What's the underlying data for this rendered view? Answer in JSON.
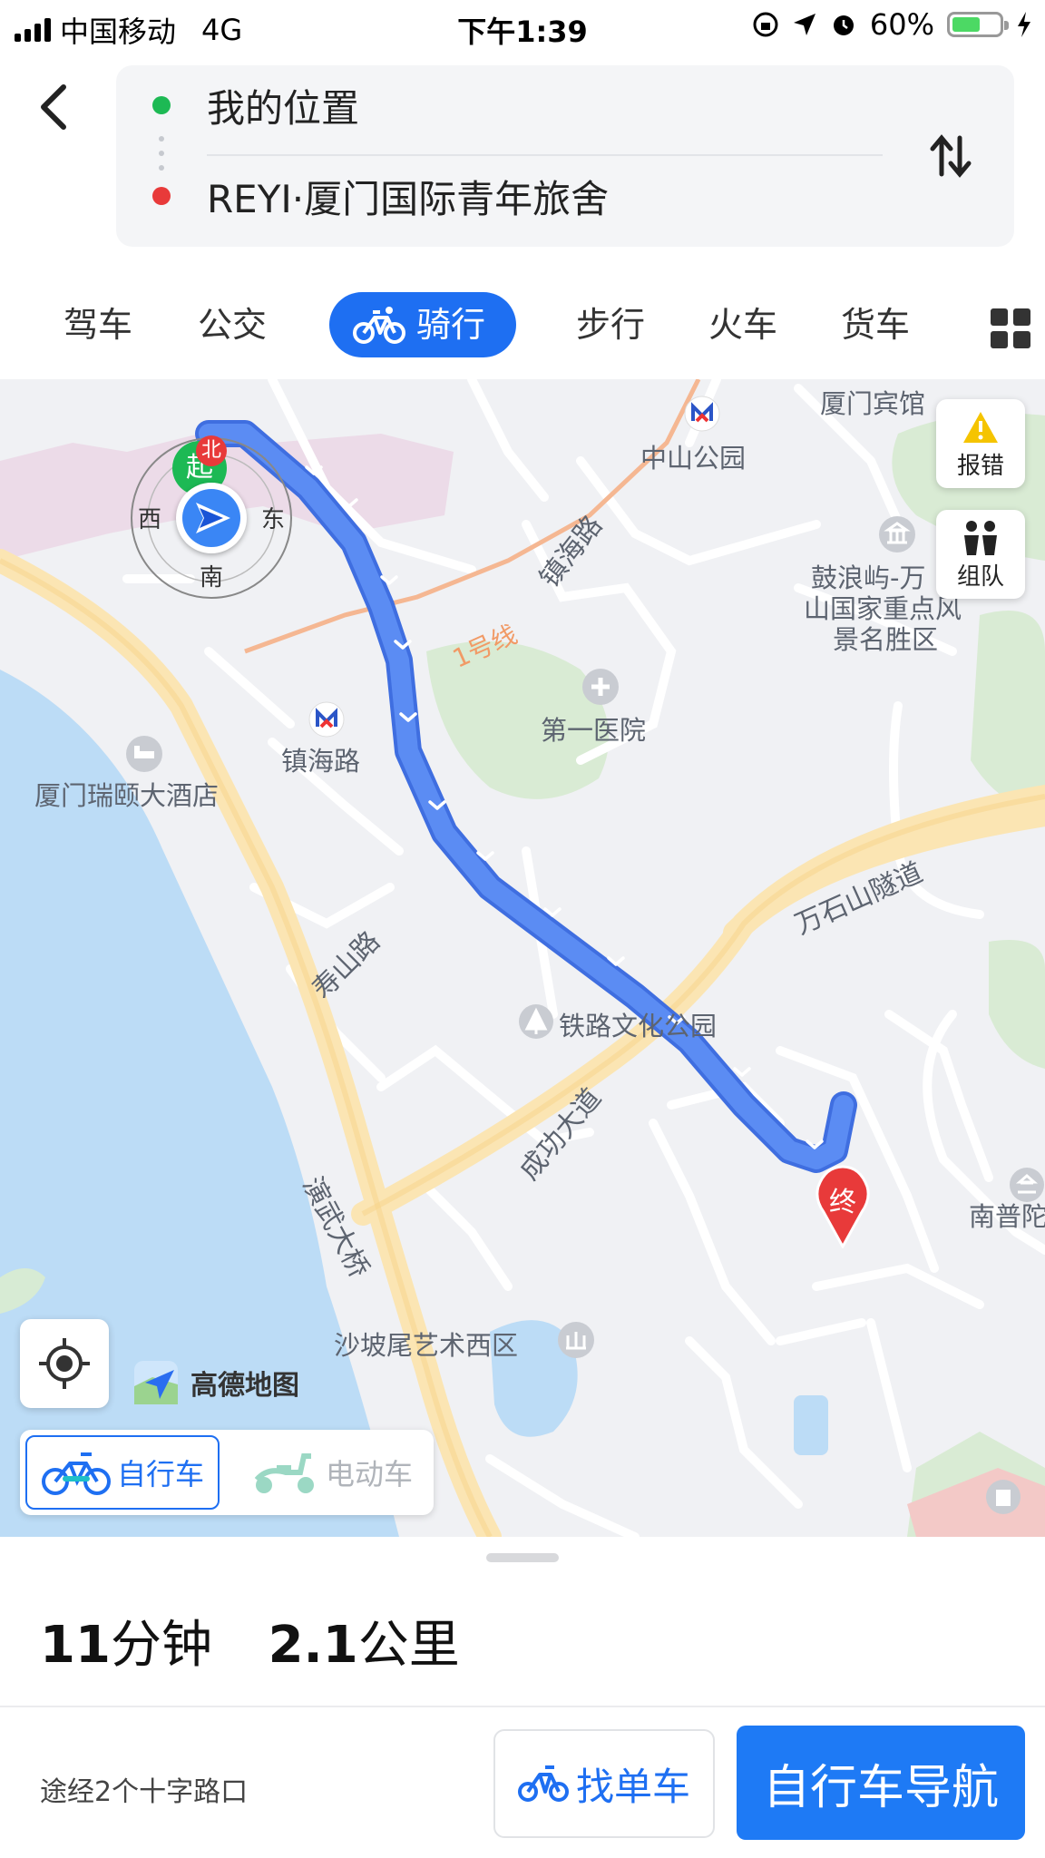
{
  "status_bar": {
    "carrier": "中国移动",
    "network": "4G",
    "time": "下午1:39",
    "battery_percent": "60%",
    "battery_level": 0.6
  },
  "route": {
    "origin": "我的位置",
    "destination": "REYI·厦门国际青年旅舍"
  },
  "modes": {
    "drive": "驾车",
    "bus": "公交",
    "cycle": "骑行",
    "walk": "步行",
    "train": "火车",
    "truck": "货车"
  },
  "map": {
    "side_buttons": {
      "report": "报错",
      "team": "组队"
    },
    "compass": {
      "north": "北",
      "west": "西",
      "east": "东",
      "south": "南",
      "start": "起"
    },
    "end_marker": "终",
    "labels": {
      "xiamen_hotel": "厦门宾馆",
      "zhongshan_park": "中山公园",
      "zhenhai_rd_diag": "镇海路",
      "line1": "1号线",
      "gulangyu_1": "鼓浪屿-万",
      "gulangyu_2": "山国家重点风",
      "gulangyu_3": "景名胜区",
      "first_hospital": "第一医院",
      "zhenhai_rd_station": "镇海路",
      "ruiyi_hotel": "厦门瑞颐大酒店",
      "wanshishan_tunnel": "万石山隧道",
      "shoushan_rd": "寿山路",
      "railway_park": "铁路文化公园",
      "chenggong_ave": "成功大道",
      "yanwu_bridge": "演武大桥",
      "nanputuo": "南普陀",
      "shapowei": "沙坡尾艺术西区"
    },
    "brand": "高德地图",
    "vehicle": {
      "bike": "自行车",
      "ebike": "电动车"
    }
  },
  "summary": {
    "minutes": "11",
    "min_unit": "分钟",
    "distance": "2.1",
    "dist_unit": "公里"
  },
  "via": "途经2个十字路口",
  "actions": {
    "find_bike": "找单车",
    "navigate": "自行车导航"
  },
  "colors": {
    "accent": "#1e6ff2",
    "route": "#4f7ff0",
    "start_green": "#1db954",
    "end_red": "#e83a3a"
  }
}
